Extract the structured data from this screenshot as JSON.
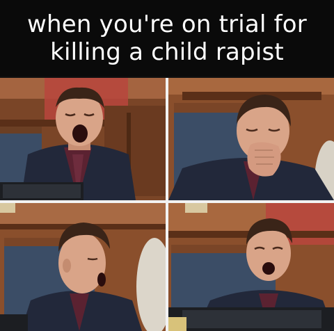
{
  "caption": {
    "line1": "when you're on trial for",
    "line2": "killing a child rapist"
  },
  "panels": [
    {
      "expression": "yawning, eyes closed, mouth wide open"
    },
    {
      "expression": "yawning, covering mouth with hand"
    },
    {
      "expression": "yawning, side profile"
    },
    {
      "expression": "yawning, eyes half open"
    }
  ],
  "colors": {
    "wood": "#8a4f2c",
    "wood_dark": "#5a2f18",
    "chair_blue": "#3b4d66",
    "suit": "#22283a",
    "shirt": "#5b2231",
    "skin": "#d9a488",
    "hair": "#3a2418",
    "caption_bg": "#0a0a0a",
    "caption_text": "#ffffff"
  }
}
